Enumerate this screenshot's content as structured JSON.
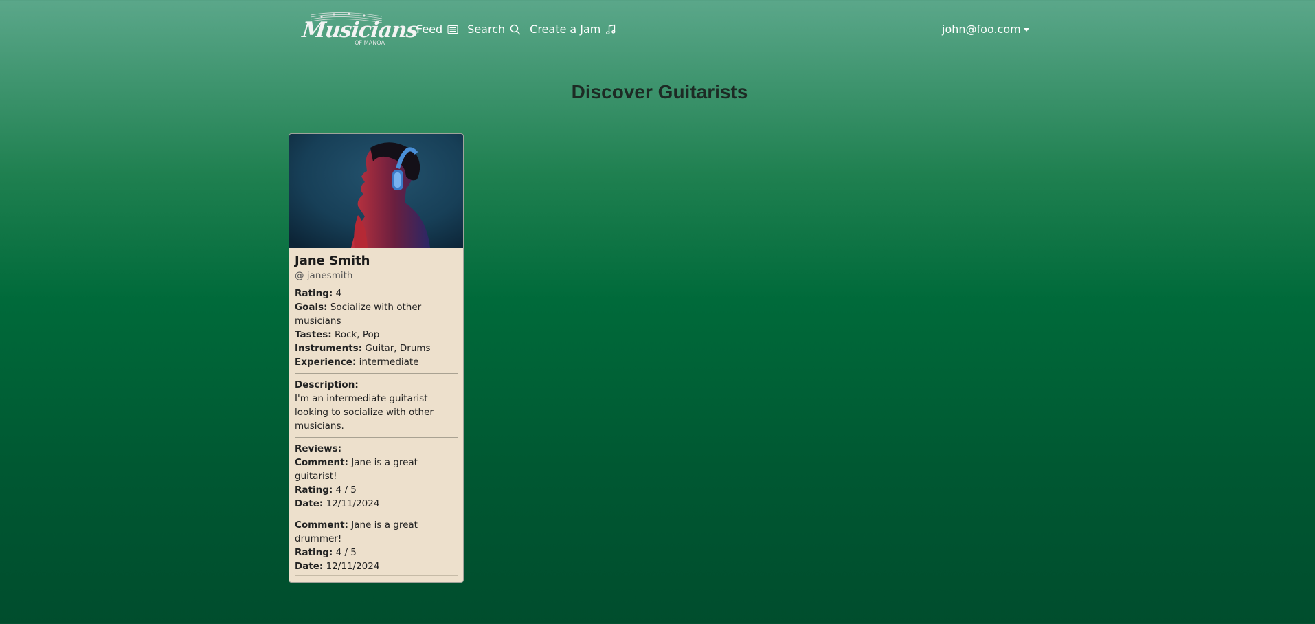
{
  "nav": {
    "logo_title": "Musicians",
    "logo_sub": "OF MANOA",
    "links": [
      {
        "label": "Feed",
        "icon": "newspaper-icon"
      },
      {
        "label": "Search",
        "icon": "search-icon"
      },
      {
        "label": "Create a Jam",
        "icon": "music-note-icon"
      }
    ],
    "user": "john@foo.com"
  },
  "page_title": "Discover Guitarists",
  "profile": {
    "name": "Jane Smith",
    "handle": "@ janesmith",
    "rating_label": "Rating:",
    "rating": "4",
    "goals_label": "Goals:",
    "goals": "Socialize with other musicians",
    "tastes_label": "Tastes:",
    "tastes": "Rock, Pop",
    "instruments_label": "Instruments:",
    "instruments": "Guitar, Drums",
    "experience_label": "Experience:",
    "experience": "intermediate",
    "description_label": "Description:",
    "description": "I'm an intermediate guitarist looking to socialize with other musicians.",
    "reviews_label": "Reviews:",
    "reviews": [
      {
        "comment_label": "Comment:",
        "comment": "Jane is a great guitarist!",
        "rating_label": "Rating:",
        "rating": "4 / 5",
        "date_label": "Date:",
        "date": "12/11/2024"
      },
      {
        "comment_label": "Comment:",
        "comment": "Jane is a great drummer!",
        "rating_label": "Rating:",
        "rating": "4 / 5",
        "date_label": "Date:",
        "date": "12/11/2024"
      }
    ]
  },
  "colors": {
    "card_bg": "#ede0cc",
    "nav_text": "#ffffff",
    "title_text": "#1d2a24"
  }
}
